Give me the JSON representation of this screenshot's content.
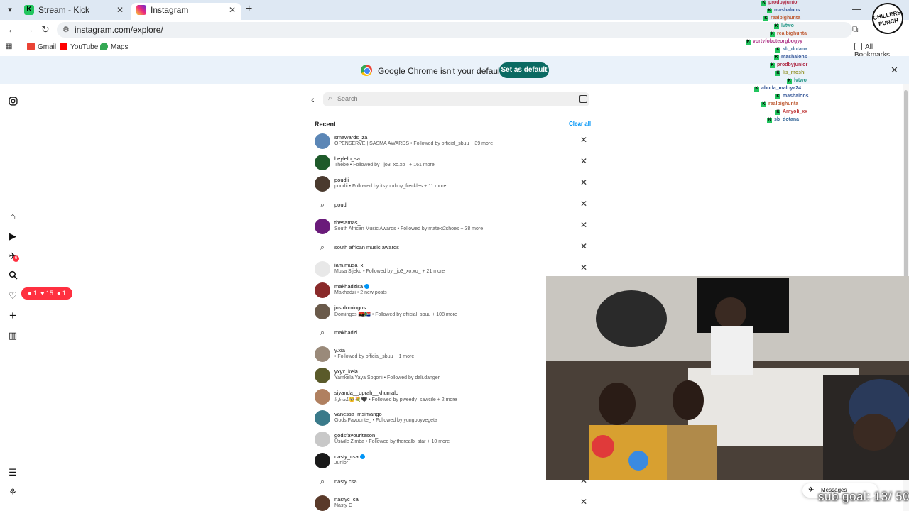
{
  "browser": {
    "tabs": [
      {
        "title": "Stream - Kick Dashboard",
        "favicon": "kick-icon",
        "active": false
      },
      {
        "title": "Instagram",
        "favicon": "instagram-icon",
        "active": true
      }
    ],
    "url": "instagram.com/explore/",
    "bookmarks": [
      {
        "label": "Gmail",
        "icon": "gmail-icon"
      },
      {
        "label": "YouTube",
        "icon": "youtube-icon"
      },
      {
        "label": "Maps",
        "icon": "maps-icon"
      }
    ],
    "all_bookmarks_label": "All Bookmarks",
    "window_controls": {
      "minimize": "—",
      "close": "✕"
    },
    "kick_badge": "K"
  },
  "banner": {
    "text": "Google Chrome isn't your default browser",
    "button": "Set as default"
  },
  "instagram": {
    "notification_pill": {
      "comments": "1",
      "likes": "15",
      "follows": "1"
    },
    "notification_dot": "6",
    "search": {
      "placeholder": "Search",
      "recent_label": "Recent",
      "clear_all": "Clear all",
      "results": [
        {
          "type": "account",
          "username": "smawards_za",
          "subtitle": "OPENSERVE | SASMA AWARDS • Followed by official_sbuu + 39 more",
          "verified": false,
          "avatar_color": "#5b86b6"
        },
        {
          "type": "account",
          "username": "heylelo_sa",
          "subtitle": "Thebe • Followed by _jo3_xo.xo_ + 161 more",
          "verified": false,
          "avatar_color": "#1e5a2a"
        },
        {
          "type": "account",
          "username": "poudii",
          "subtitle": "poudii • Followed by itsyourboy_freckles + 11 more",
          "verified": false,
          "avatar_color": "#4a3a2e"
        },
        {
          "type": "query",
          "text": "poudi"
        },
        {
          "type": "account",
          "username": "thesamas_",
          "subtitle": "South African Music Awards • Followed by mateki2shoes + 38 more",
          "verified": false,
          "avatar_color": "#6a1b7a"
        },
        {
          "type": "query",
          "text": "south african music awards"
        },
        {
          "type": "account",
          "username": "iam.musa_x",
          "subtitle": "Musa Sijeku • Followed by _jo3_xo.xo_ + 21 more",
          "verified": false,
          "avatar_color": "#e8e8e8"
        },
        {
          "type": "account",
          "username": "makhadzisa",
          "subtitle": "Makhadzi • 2 new posts",
          "verified": true,
          "avatar_color": "#8a2a2a"
        },
        {
          "type": "account",
          "username": "justdomingos",
          "subtitle": "Domingos 🇦🇴🇿🇦 • Followed by official_sbuu + 108 more",
          "verified": false,
          "avatar_color": "#6a5a4a"
        },
        {
          "type": "query",
          "text": "makhadzi"
        },
        {
          "type": "account",
          "username": "y.xia__",
          "subtitle": "• Followed by official_sbuu + 1 more",
          "verified": false,
          "avatar_color": "#9a8a7a"
        },
        {
          "type": "account",
          "username": "yxyx_kela",
          "subtitle": "Yamkela Yaya Sogoni • Followed by dali.danger",
          "verified": false,
          "avatar_color": "#5a5a2a"
        },
        {
          "type": "account",
          "username": "siyanda__oprah__khumalo",
          "subtitle": "ℰ𝓅𝓇𝒶𝒽🥹💐🖤 • Followed by pweedy_sawcile + 2 more",
          "verified": false,
          "avatar_color": "#b08060"
        },
        {
          "type": "account",
          "username": "vanessa_msimango",
          "subtitle": "Gods.Favourite_ • Followed by yungboyvegeta",
          "verified": false,
          "avatar_color": "#3a7a8a"
        },
        {
          "type": "account",
          "username": "godsfavouriteson_",
          "subtitle": "Usivile Zimba • Followed by therealb_star + 10 more",
          "verified": false,
          "avatar_color": "#c8c8c8"
        },
        {
          "type": "account",
          "username": "nasty_csa",
          "subtitle": "Junior",
          "verified": true,
          "avatar_color": "#1a1a1a"
        },
        {
          "type": "query",
          "text": "nasty csa"
        },
        {
          "type": "account",
          "username": "nastyc_ca",
          "subtitle": "Nasty C",
          "verified": false,
          "avatar_color": "#5a3a2a"
        }
      ]
    }
  },
  "stream_overlay": {
    "chat": [
      {
        "user": "prodbyjunior",
        "color": "#b0304a"
      },
      {
        "user": "mashalons",
        "color": "#3a5a9a"
      },
      {
        "user": "realbighunta",
        "color": "#c0603a"
      },
      {
        "user": "lvtwo",
        "color": "#2a9a8a"
      },
      {
        "user": "realbighunta",
        "color": "#c0603a"
      },
      {
        "user": "vortvfobcteorgbogyy",
        "color": "#b03a8a"
      },
      {
        "user": "sb_dotana",
        "color": "#3a6a9a"
      },
      {
        "user": "mashalons",
        "color": "#3a5a9a"
      },
      {
        "user": "prodbyjunior",
        "color": "#b0304a"
      },
      {
        "user": "lis_moshi",
        "color": "#9a9a3a"
      },
      {
        "user": "lvtwo",
        "color": "#2a9a8a"
      },
      {
        "user": "abuda_malcya24",
        "color": "#3a5a9a"
      },
      {
        "user": "mashalons",
        "color": "#3a5a9a"
      },
      {
        "user": "realbighunta",
        "color": "#c0603a"
      },
      {
        "user": "Amyoli_xx",
        "color": "#c03a3a"
      },
      {
        "user": "sb_dotana",
        "color": "#3a6a9a"
      }
    ],
    "sticker_text": "CHILLERS PUNCH",
    "messages_label": "Messages",
    "sub_goal": "sub goal: 13/ 50"
  }
}
